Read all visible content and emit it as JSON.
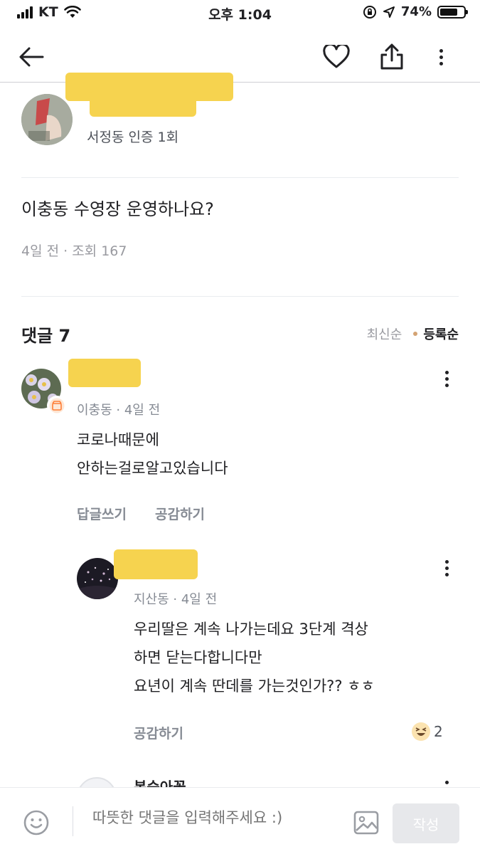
{
  "status_bar": {
    "carrier": "KT",
    "time": "오후 1:04",
    "battery": "74%",
    "battery_level": 0.74
  },
  "post": {
    "author_location": "서정동 인증 1회",
    "title": "이충동 수영장 운영하나요?",
    "meta": "4일 전 · 조회 167"
  },
  "comments_section": {
    "count_label": "댓글 7",
    "sort_latest": "최신순",
    "sort_registered": "등록순"
  },
  "comments": [
    {
      "location_time": "이충동 · 4일 전",
      "lines": [
        "코로나때문에",
        "안하는걸로알고있습니다"
      ],
      "reply_label": "답글쓰기",
      "like_label": "공감하기"
    }
  ],
  "reply": {
    "location_time": "지산동 · 4일 전",
    "lines": [
      "우리딸은 계속 나가는데요 3단계 격상",
      "하면 닫는다합니다만",
      "요년이 계속 딴데를 가는것인가?? ㅎㅎ"
    ],
    "like_label": "공감하기",
    "reaction_count": "2"
  },
  "next_comment": {
    "nickname_partial": "복숭아꽃"
  },
  "composer": {
    "placeholder": "따뜻한 댓글을 입력해주세요 :)",
    "submit_label": "작성"
  },
  "colors": {
    "redaction": "#f6d34f",
    "accent_dot": "#d4a373",
    "muted_text": "#868b94"
  }
}
